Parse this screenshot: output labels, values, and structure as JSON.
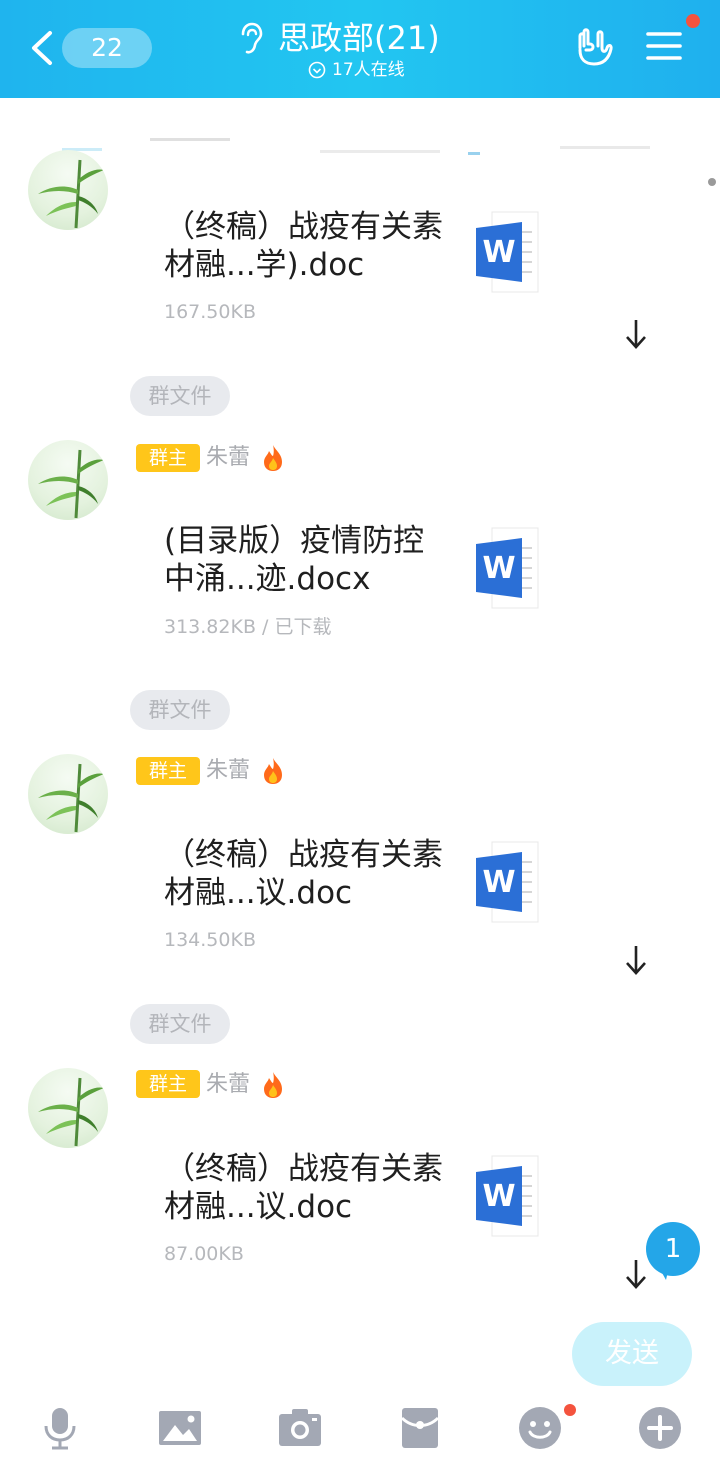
{
  "header": {
    "unread_count": "22",
    "title": "思政部(21)",
    "online_status": "17人在线"
  },
  "messages": [
    {
      "file_name": "（终稿）战疫有关素材融...学).doc",
      "file_meta": "167.50KB"
    },
    {
      "tag": "群文件",
      "badge": "群主",
      "sender": "朱蕾",
      "file_name": "(目录版）疫情防控中涌...迹.docx",
      "file_meta": "313.82KB / 已下载"
    },
    {
      "tag": "群文件",
      "badge": "群主",
      "sender": "朱蕾",
      "file_name": "（终稿）战疫有关素材融...议.doc",
      "file_meta": "134.50KB"
    },
    {
      "tag": "群文件",
      "badge": "群主",
      "sender": "朱蕾",
      "file_name": "（终稿）战疫有关素材融...议.doc",
      "file_meta": "87.00KB"
    }
  ],
  "new_message_count": "1",
  "send_label": "发送",
  "toolbar": {
    "icons": [
      "microphone-icon",
      "image-icon",
      "camera-icon",
      "red-packet-icon",
      "emoji-icon",
      "plus-icon"
    ]
  },
  "colors": {
    "header": "#22c6f1",
    "badge": "#ffc61a",
    "word": "#2b6fd6",
    "notification_dot": "#f4533e"
  }
}
